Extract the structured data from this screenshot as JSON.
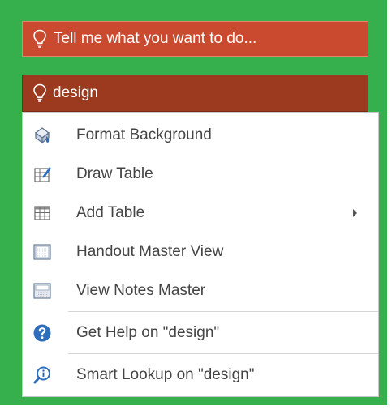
{
  "tell_me": {
    "placeholder": "Tell me what you want to do...",
    "icon": "lightbulb-icon"
  },
  "search": {
    "value": "design",
    "icon": "lightbulb-icon"
  },
  "menu": {
    "items": [
      {
        "label": "Format Background",
        "icon": "format-background-icon"
      },
      {
        "label": "Draw Table",
        "icon": "draw-table-icon"
      },
      {
        "label": "Add Table",
        "icon": "add-table-icon",
        "has_submenu": true
      },
      {
        "label": "Handout Master View",
        "icon": "handout-master-icon"
      },
      {
        "label": "View Notes Master",
        "icon": "notes-master-icon"
      },
      {
        "label": "Get Help on \"design\"",
        "icon": "help-icon"
      },
      {
        "label": "Smart Lookup on \"design\"",
        "icon": "smart-lookup-icon"
      }
    ]
  },
  "colors": {
    "background": "#35b04c",
    "tell_me_box": "#c94a2e",
    "search_box": "#9c3a1f",
    "help_blue": "#2d6ebd"
  }
}
